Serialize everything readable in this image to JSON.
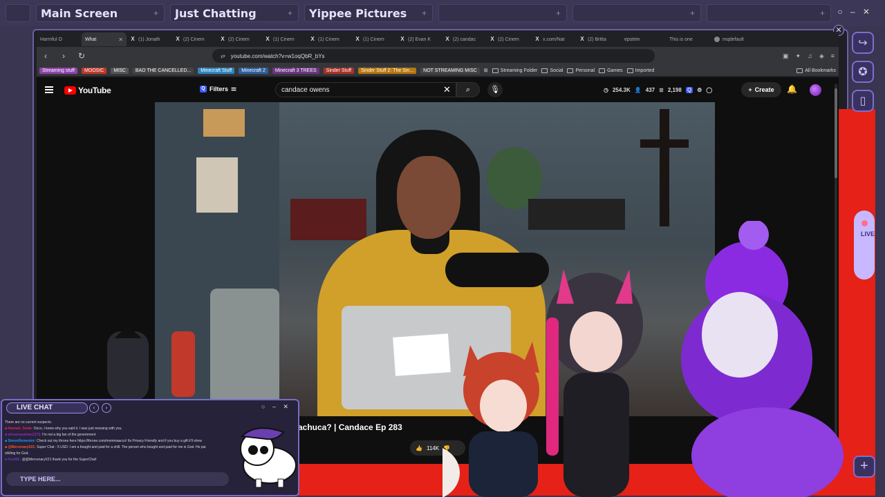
{
  "scenes": {
    "tabs": [
      {
        "label": "Main Screen"
      },
      {
        "label": "Just Chatting"
      },
      {
        "label": "Yippee Pictures"
      },
      {
        "label": ""
      },
      {
        "label": ""
      },
      {
        "label": ""
      }
    ],
    "controls": "○ – ✕"
  },
  "browser": {
    "tabs": [
      {
        "title": "Harmful O",
        "icon": "youtube-icon"
      },
      {
        "title": "What",
        "icon": "youtube-icon",
        "active": true
      },
      {
        "title": "(1) Jonath",
        "icon": "x-icon"
      },
      {
        "title": "(2) Cinem",
        "icon": "x-icon"
      },
      {
        "title": "(2) Cinem",
        "icon": "x-icon"
      },
      {
        "title": "(1) Cinem",
        "icon": "x-icon"
      },
      {
        "title": "(1) Cinem",
        "icon": "x-icon"
      },
      {
        "title": "(1) Cinem",
        "icon": "x-icon"
      },
      {
        "title": "(2) Evan K",
        "icon": "x-icon"
      },
      {
        "title": "(2) candac",
        "icon": "x-icon"
      },
      {
        "title": "(2) Cinem",
        "icon": "x-icon"
      },
      {
        "title": "x.com/Nat",
        "icon": "x-icon"
      },
      {
        "title": "(2) Britta",
        "icon": "x-icon"
      },
      {
        "title": "epstein",
        "icon": "youtube-icon"
      },
      {
        "title": "This is one",
        "icon": "youtube-icon"
      },
      {
        "title": "mqdefault",
        "icon": "globe-icon"
      }
    ],
    "url": "youtube.com/watch?v=w1oqQbR_bYs",
    "bookmarks": [
      {
        "label": "Streaming stuff",
        "color": "#8e44ad"
      },
      {
        "label": "MOOSIC",
        "color": "#c0392b"
      },
      {
        "label": "MISC",
        "color": "#555555"
      },
      {
        "label": "BAO THE CANCELLED...",
        "color": "#444444"
      },
      {
        "label": "Minecraft Stuff",
        "color": "#2e86c1"
      },
      {
        "label": "Minecraft 2",
        "color": "#2e5fa1"
      },
      {
        "label": "Minecraft 3 TREES",
        "color": "#6c3483"
      },
      {
        "label": "Sinder Stuff",
        "color": "#a93226"
      },
      {
        "label": "Sinder Stuff 2: The Sin...",
        "color": "#b9770e"
      },
      {
        "label": "NOT STREAMING MISC",
        "color": "#444444"
      }
    ],
    "bookmark_folders": [
      "Streaming Folder",
      "Social",
      "Personal",
      "Games",
      "Imported"
    ],
    "all_bookmarks": "All Bookmarks"
  },
  "youtube": {
    "logo": "YouTube",
    "filters": "Filters",
    "search_value": "candace owens",
    "stats": {
      "views": "254.3K",
      "count2": "437",
      "count3": "2,198"
    },
    "create": "Create",
    "video_title": "achuca? | Candace Ep 283",
    "likes": "114K"
  },
  "dock": {
    "live_label": "LIVE"
  },
  "chat": {
    "title": "LIVE CHAT",
    "controls": "○ – ✕",
    "messages": [
      {
        "name": "",
        "text": "There are no current suspects."
      },
      {
        "name": "Hannah_Swab:",
        "text": "Ooco, I knew why you said it. I was just messing with you."
      },
      {
        "name": "whoareaudrian1272:",
        "text": "I'm not a big fan of the government"
      },
      {
        "name": "SimonDementor:",
        "text": "Check out my throne here https://throne.com/mommaacco! Its Privacy Friendly and if you buy a gift it'll show"
      },
      {
        "name": "@MercenaryX21:",
        "text": "Super Chat - 5 USD: I am a bought and paid for a shill. The person who bought and paid for me is God. He pai"
      },
      {
        "name": "",
        "text": "shilling for God."
      },
      {
        "name": "KiwiBE:",
        "text": "@@MercenaryX21 thank you for the SuperChat!"
      }
    ],
    "input_placeholder": "TYPE HERE..."
  },
  "colors": {
    "accent": "#7e6fd0",
    "scene_text": "#e8e0ff",
    "youtube_red": "#ff0000"
  }
}
